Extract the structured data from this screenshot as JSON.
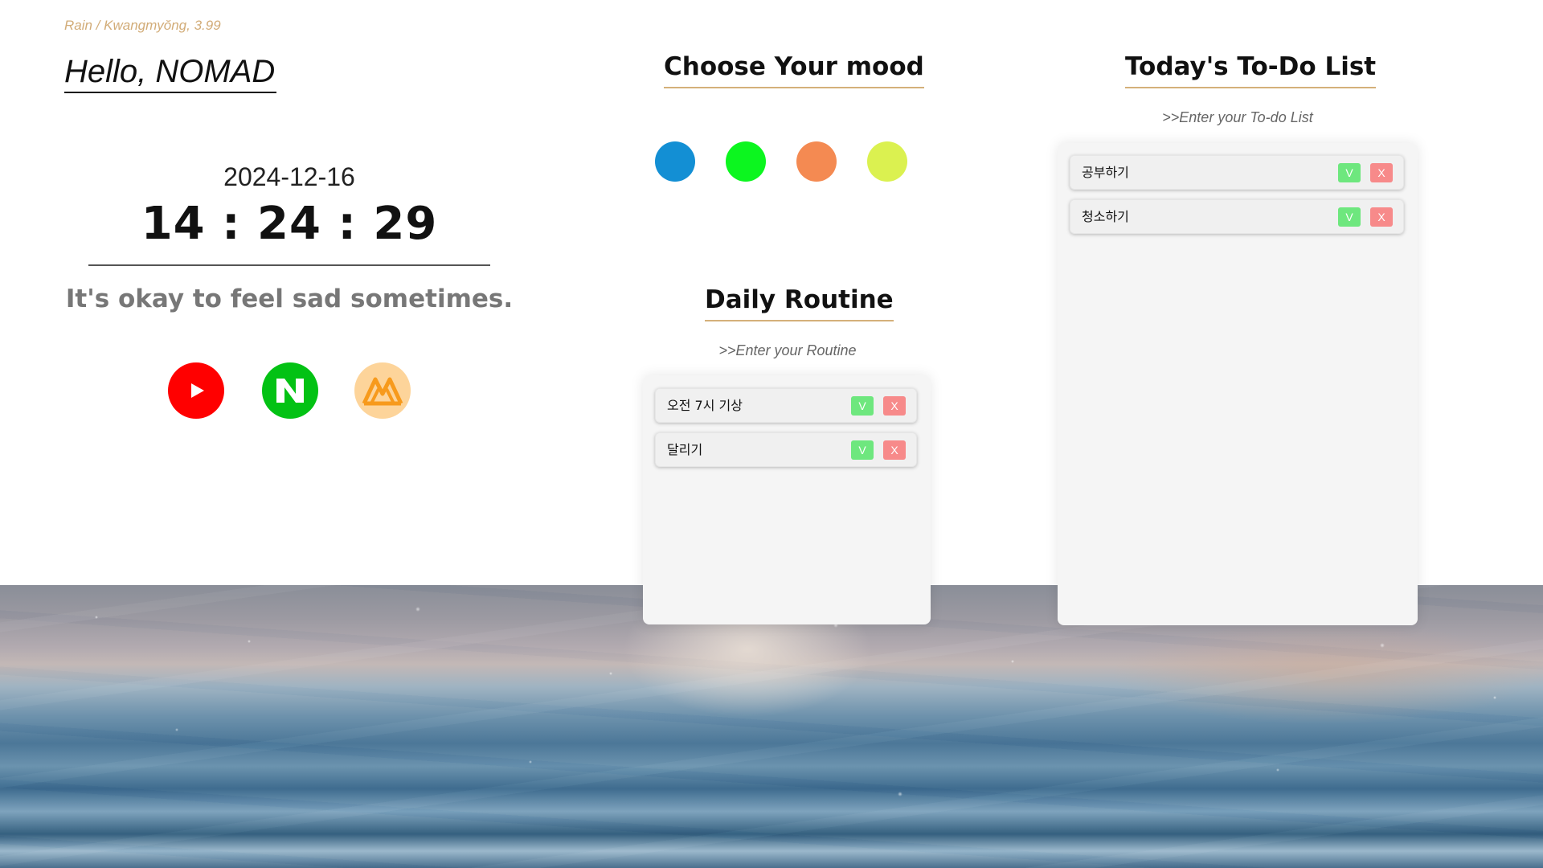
{
  "weather": {
    "text": "Rain / Kwangmyŏng, 3.99"
  },
  "greeting": {
    "text": "Hello, NOMAD"
  },
  "clock": {
    "date": "2024-12-16",
    "time": "14 : 24 : 29"
  },
  "quote": {
    "text": "It's okay to feel sad sometimes."
  },
  "links": [
    {
      "name": "youtube",
      "icon": "youtube-play-icon",
      "color": "#ff0000"
    },
    {
      "name": "naver",
      "icon": "naver-n-icon",
      "color": "#03c214"
    },
    {
      "name": "melon",
      "icon": "melon-logo-icon",
      "color": "#fdd49a"
    }
  ],
  "mood": {
    "title": "Choose Your mood",
    "colors": [
      "#138fd4",
      "#0cf61f",
      "#f48a52",
      "#dbf150"
    ]
  },
  "routine": {
    "title": "Daily Routine",
    "placeholder": ">>Enter your Routine",
    "items": [
      {
        "label": "오전 7시 기상",
        "check_label": "V",
        "delete_label": "X"
      },
      {
        "label": "달리기",
        "check_label": "V",
        "delete_label": "X"
      }
    ]
  },
  "todo": {
    "title": "Today's To-Do List",
    "placeholder": ">>Enter your To-do List",
    "items": [
      {
        "label": "공부하기",
        "check_label": "V",
        "delete_label": "X"
      },
      {
        "label": "청소하기",
        "check_label": "V",
        "delete_label": "X"
      }
    ]
  },
  "theme": {
    "accent": "#d4b07a",
    "check_color": "#6ee77e",
    "delete_color": "#f78a8a"
  }
}
